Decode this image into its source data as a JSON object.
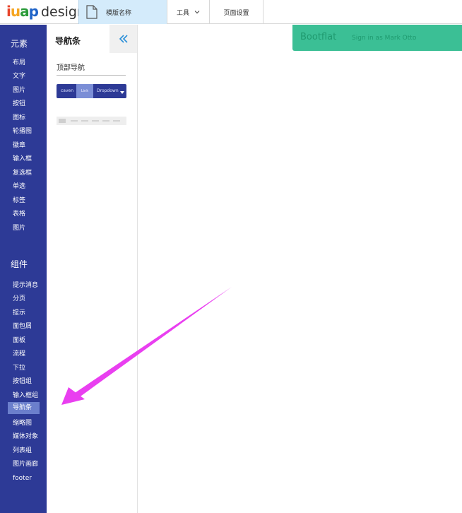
{
  "header": {
    "logo_brand": [
      "i",
      "u",
      "a",
      "p"
    ],
    "logo_word": "design",
    "template_tab": "模版名称",
    "tools_tab": "工具",
    "page_settings_tab": "页面设置"
  },
  "sidebar": {
    "section1_title": "元素",
    "elements": [
      "布局",
      "文字",
      "图片",
      "按钮",
      "图标",
      "轮播图",
      "徽章",
      "输入框",
      "复选框",
      "单选",
      "标签",
      "表格",
      "图片"
    ],
    "section2_title": "组件",
    "components": [
      "提示消息",
      "分页",
      "提示",
      "面包屑",
      "面板",
      "流程",
      "下拉",
      "按钮组",
      "输入框组",
      "导航条",
      "缩略图",
      "媒体对象",
      "列表组",
      "图片画廊",
      "footer"
    ],
    "active_item": "导航条"
  },
  "panel": {
    "title": "导航条",
    "subtitle": "顶部导航",
    "preview_brand": "caven",
    "preview_link": "Link",
    "preview_dropdown": "Dropdown"
  },
  "canvas": {
    "navbar_brand": "Bootflat",
    "navbar_signin": "Sign in as Mark Otto"
  },
  "colors": {
    "sidebar_bg": "#2d3a96",
    "active_item_bg": "#6b7fcc",
    "navbar_bg": "#3bbf95",
    "annotation_arrow": "#e93ff0"
  },
  "icons": {
    "template_tab": "document-icon",
    "tools_tab": "chevron-down-icon",
    "collapse_button": "double-chevron-left-icon"
  }
}
